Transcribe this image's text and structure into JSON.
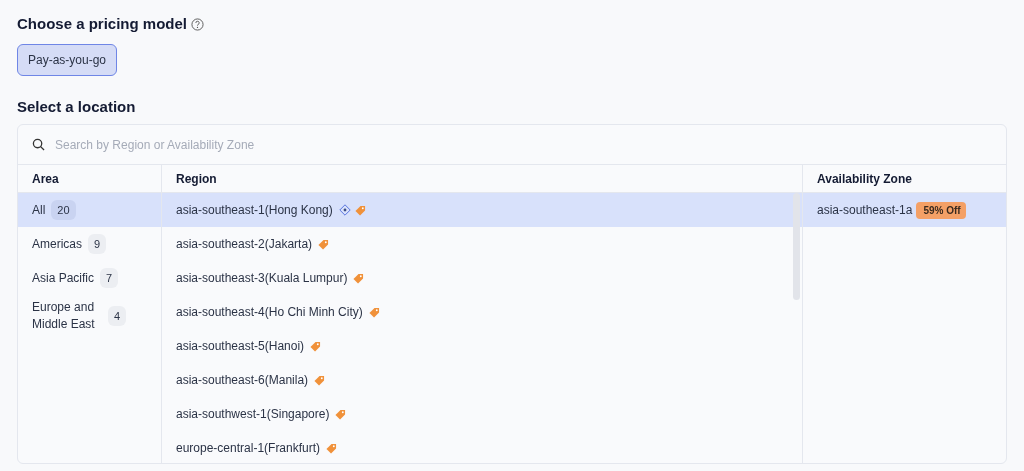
{
  "pricing": {
    "title": "Choose a pricing model",
    "options": [
      {
        "label": "Pay-as-you-go",
        "selected": true
      }
    ]
  },
  "location": {
    "title": "Select a location",
    "search": {
      "placeholder": "Search by Region or Availability Zone"
    },
    "columns": [
      "Area",
      "Region",
      "Availability Zone"
    ],
    "areas": [
      {
        "name": "All",
        "count": "20",
        "selected": true
      },
      {
        "name": "Americas",
        "count": "9",
        "selected": false
      },
      {
        "name": "Asia Pacific",
        "count": "7",
        "selected": false
      },
      {
        "name": "Europe and Middle East",
        "count": "4",
        "selected": false
      }
    ],
    "regions": [
      {
        "name": "asia-southeast-1(Hong Kong)",
        "selected": true,
        "featured": true,
        "discount": true
      },
      {
        "name": "asia-southeast-2(Jakarta)",
        "selected": false,
        "featured": false,
        "discount": true
      },
      {
        "name": "asia-southeast-3(Kuala Lumpur)",
        "selected": false,
        "featured": false,
        "discount": true
      },
      {
        "name": "asia-southeast-4(Ho Chi Minh City)",
        "selected": false,
        "featured": false,
        "discount": true
      },
      {
        "name": "asia-southeast-5(Hanoi)",
        "selected": false,
        "featured": false,
        "discount": true
      },
      {
        "name": "asia-southeast-6(Manila)",
        "selected": false,
        "featured": false,
        "discount": true
      },
      {
        "name": "asia-southwest-1(Singapore)",
        "selected": false,
        "featured": false,
        "discount": true
      },
      {
        "name": "europe-central-1(Frankfurt)",
        "selected": false,
        "featured": false,
        "discount": true
      }
    ],
    "zones": [
      {
        "name": "asia-southeast-1a",
        "selected": true,
        "tag": "59% Off"
      }
    ]
  }
}
